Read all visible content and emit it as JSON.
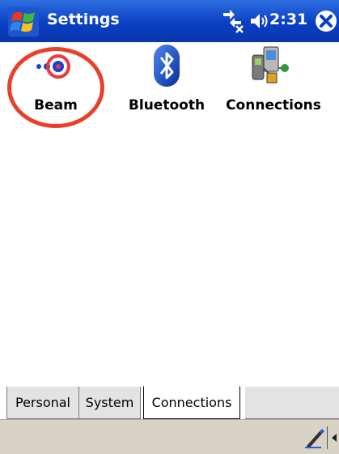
{
  "titlebar": {
    "title": "Settings",
    "time": "2:31",
    "start_icon": "windows-flag-icon",
    "connectivity_icon": "connectivity-icon",
    "volume_icon": "speaker-icon",
    "close_icon": "close-icon"
  },
  "applets": [
    {
      "label": "Beam",
      "icon": "beam-icon"
    },
    {
      "label": "Bluetooth",
      "icon": "bluetooth-icon"
    },
    {
      "label": "Connections",
      "icon": "connections-icon"
    }
  ],
  "tabs": [
    {
      "label": "Personal",
      "active": false
    },
    {
      "label": "System",
      "active": false
    },
    {
      "label": "Connections",
      "active": true
    }
  ],
  "cmdbar": {
    "sip_icon": "pen-input-icon",
    "sip_arrow_icon": "input-menu-arrow-icon"
  },
  "colors": {
    "titlebar": "#0a3fc4",
    "highlight": "#e8402b",
    "tab_inactive": "#e3e3e3",
    "cmdbar": "#d9d3c6"
  }
}
